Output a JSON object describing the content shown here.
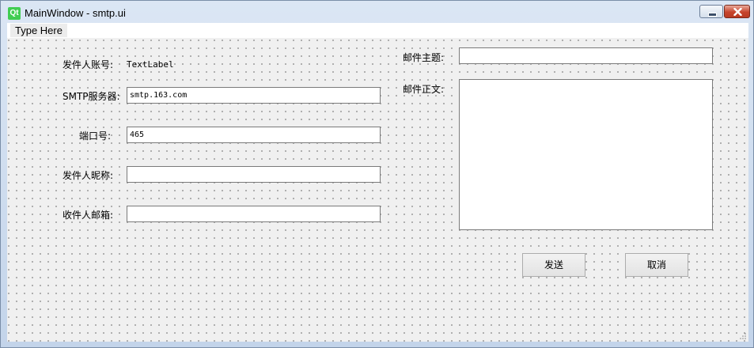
{
  "window": {
    "logo_text": "Qt",
    "title": "MainWindow - smtp.ui"
  },
  "menubar": {
    "items": [
      "Type Here"
    ]
  },
  "form": {
    "sender_account_label": "发件人账号:",
    "sender_account_value": "TextLabel",
    "smtp_server_label": "SMTP服务器:",
    "smtp_server_value": "smtp.163.com",
    "port_label": "端口号:",
    "port_value": "465",
    "sender_nickname_label": "发件人昵称:",
    "sender_nickname_value": "",
    "recipient_email_label": "收件人邮箱:",
    "recipient_email_value": "",
    "subject_label": "邮件主题:",
    "subject_value": "",
    "body_label": "邮件正文:",
    "body_value": ""
  },
  "buttons": {
    "send": "发送",
    "cancel": "取消"
  },
  "colors": {
    "qt_green": "#41cd52",
    "close_red": "#c7452d",
    "canvas_bg": "#f0f0f0"
  }
}
